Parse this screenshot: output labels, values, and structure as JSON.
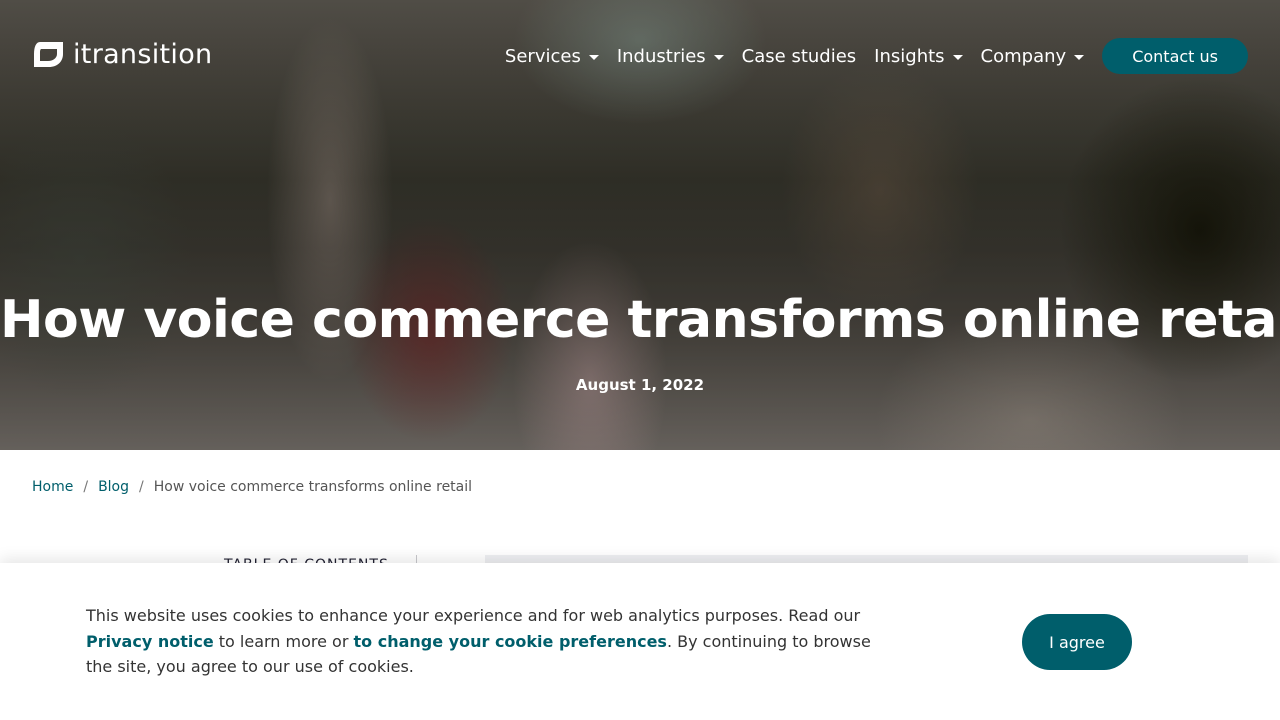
{
  "brand": {
    "name": "itransition",
    "accent": "#005e6b",
    "logo_icon": "itransition-leaf-icon"
  },
  "nav": {
    "items": [
      {
        "label": "Services",
        "has_dropdown": true
      },
      {
        "label": "Industries",
        "has_dropdown": true
      },
      {
        "label": "Case studies",
        "has_dropdown": false
      },
      {
        "label": "Insights",
        "has_dropdown": true
      },
      {
        "label": "Company",
        "has_dropdown": true
      }
    ],
    "contact_label": "Contact us"
  },
  "hero": {
    "title": "How voice commerce transforms online retail",
    "date": "August 1, 2022"
  },
  "breadcrumb": {
    "home": "Home",
    "blog": "Blog",
    "separator": "/",
    "current": "How voice commerce transforms online retail"
  },
  "toc": {
    "label": "TABLE OF CONTENTS"
  },
  "cookie": {
    "text_1": "This website uses cookies to enhance your experience and for web analytics purposes. Read our ",
    "link_privacy": "Privacy notice",
    "text_2": " to learn more or ",
    "link_preferences": "to change your cookie preferences",
    "text_3": ". By continuing to browse the site, you agree to our use of cookies.",
    "agree_label": "I agree"
  }
}
